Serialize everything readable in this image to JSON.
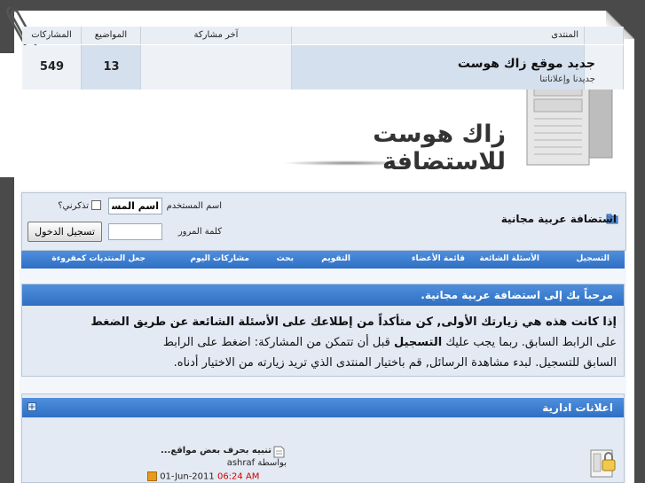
{
  "header": {
    "logo_text": "زاك هوست للاستضافة"
  },
  "navbar": {
    "title": "استضافة عربية مجانية",
    "username_label": "اسم المستخدم",
    "username_value": "اسم المستخدم",
    "remember_label": "تذكرني؟",
    "password_label": "كلمة المرور",
    "login_button": "تسجيل الدخول",
    "menu": [
      "التسجيل",
      "الأسئلة الشائعة",
      "قائمة الأعضاء",
      "التقويم",
      "بحث",
      "مشاركات اليوم",
      "جعل المنتديات كمقروءة"
    ]
  },
  "welcome": {
    "title": "مرحباً بك إلى استضافة عربية مجانية.",
    "line1_a": "إذا كانت هذه هي زيارتك الأولى, كن متأكداً من إطلاعك على",
    "faq_link": "الأسئلة الشائعة",
    "line1_b": "عن طريق الضغط",
    "line2_a": "على الرابط السابق. ربما يجب عليك",
    "register_link": "التسجيل",
    "line2_b": "قبل أن تتمكن من المشاركة: اضغط على الرابط",
    "line3": "السابق للتسجيل. لبدء مشاهدة الرسائل, قم باختيار المنتدى الذي تريد زيارته من الاختيار أدناه."
  },
  "forum_section": {
    "title": "اعلانات ادارية",
    "columns": {
      "forum": "المنتدى",
      "last_post": "آخر مشاركة",
      "threads": "المواضيع",
      "posts": "المشاركات"
    },
    "rows": [
      {
        "name": "جديد موقع زاك هوست",
        "description": "جديدنا وإعلاناتنا",
        "last_post_title": "تنبيه بحرف بعض مواقع...",
        "last_post_by_label": "بواسطة",
        "last_post_user": "ashraf",
        "last_post_date": "01-Jun-2011",
        "last_post_time": "06:24 AM",
        "threads": "13",
        "posts": "549"
      }
    ]
  },
  "colors": {
    "accent": "#2e6fc4",
    "panel": "#e3eaf3",
    "time": "#cc0000"
  }
}
